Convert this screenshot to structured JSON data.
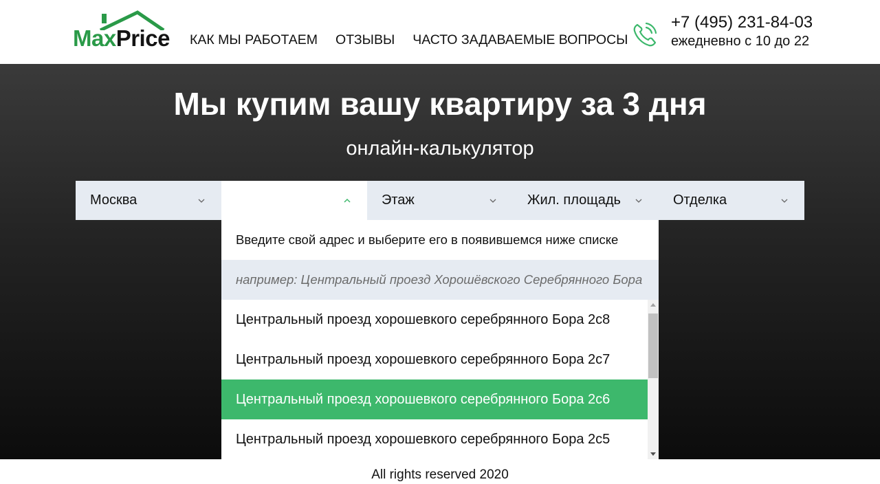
{
  "brand": {
    "part1": "Max",
    "part2": "Price",
    "logo_color": "#2a9a48"
  },
  "nav": {
    "items": [
      "КАК МЫ РАБОТАЕМ",
      "ОТЗЫВЫ",
      "ЧАСТО ЗАДАВАЕМЫЕ ВОПРОСЫ"
    ]
  },
  "contact": {
    "phone": "+7 (495) 231-84-03",
    "hours": "ежедневно с 10 до 22",
    "icon": "phone-icon"
  },
  "hero": {
    "title": "Мы купим вашу квартиру за 3 дня",
    "subtitle": "онлайн-калькулятор"
  },
  "filters": {
    "city": "Москва",
    "address": "",
    "floor": "Этаж",
    "area": "Жил. площадь",
    "finish": "Отделка"
  },
  "dropdown": {
    "hint": "Введите свой адрес и выберите его в появившемся ниже списке",
    "placeholder": "например: Центральный проезд Хорошёвского Серебрянного Бора",
    "items": [
      "Центральный проезд хорошевкого серебрянного Бора 2с8",
      "Центральный проезд хорошевкого серебрянного Бора 2с7",
      "Центральный проезд хорошевкого серебрянного Бора 2с6",
      "Центральный проезд хорошевкого серебрянного Бора 2с5"
    ],
    "selected_index": 2,
    "selected_color": "#3db86c"
  },
  "footer": {
    "text": "All rights reserved 2020"
  }
}
